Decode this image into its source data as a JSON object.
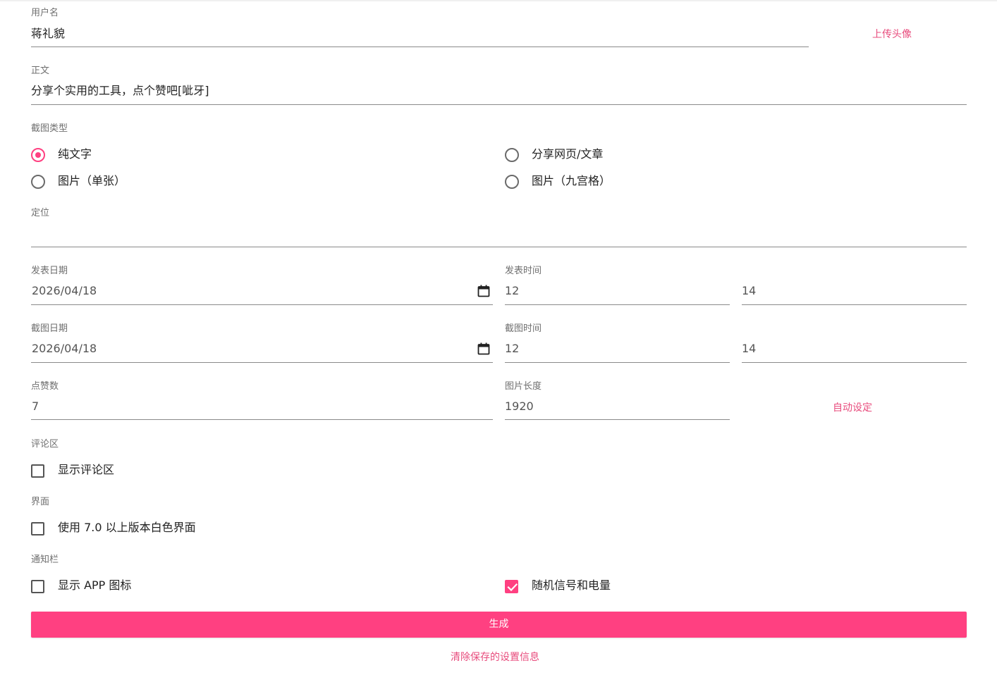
{
  "colors": {
    "accent": "#ff4081",
    "link": "#e84c7d"
  },
  "username": {
    "label": "用户名",
    "value": "蒋礼貌",
    "upload_avatar": "上传头像"
  },
  "content": {
    "label": "正文",
    "value": "分享个实用的工具，点个赞吧[呲牙]"
  },
  "screenshot_type": {
    "label": "截图类型",
    "options": [
      "纯文字",
      "分享网页/文章",
      "图片（单张）",
      "图片（九宫格）"
    ],
    "selected": "纯文字"
  },
  "location": {
    "label": "定位",
    "value": ""
  },
  "publish": {
    "date_label": "发表日期",
    "date": "2026/04/18",
    "time_label": "发表时间",
    "hour": "12",
    "minute": "14"
  },
  "capture": {
    "date_label": "截图日期",
    "date": "2026/04/18",
    "time_label": "截图时间",
    "hour": "12",
    "minute": "14"
  },
  "likes": {
    "label": "点赞数",
    "value": "7"
  },
  "image_length": {
    "label": "图片长度",
    "value": "1920",
    "auto_set": "自动设定"
  },
  "comments": {
    "label": "评论区",
    "show_label": "显示评论区",
    "checked": false
  },
  "interface": {
    "label": "界面",
    "white_ui_label": "使用 7.0 以上版本白色界面",
    "checked": false
  },
  "notification": {
    "label": "通知栏",
    "show_app_icon": "显示 APP 图标",
    "show_app_icon_checked": false,
    "random_signal": "随机信号和电量",
    "random_signal_checked": true
  },
  "generate_button": "生成",
  "clear_settings": "清除保存的设置信息",
  "icons": {
    "calendar": "calendar-icon",
    "check": "check-icon"
  }
}
